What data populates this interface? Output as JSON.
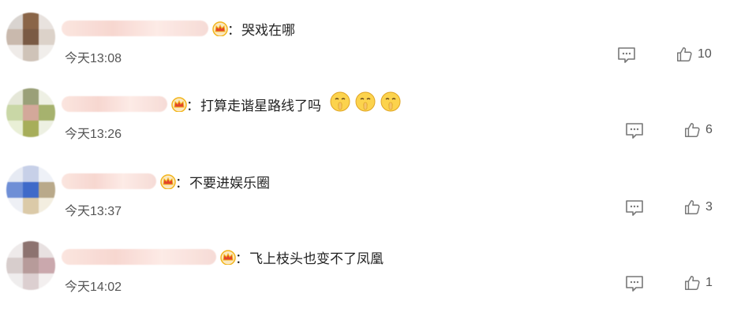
{
  "comments": [
    {
      "text": "哭戏在哪",
      "time": "今天13:08",
      "likes": "10",
      "avatar_colors": [
        "#d9d4d0",
        "#8a6548",
        "#e8e2de",
        "#c9b9ad",
        "#7a5a44",
        "#dcd2c9",
        "#efebe8",
        "#cfc3b8",
        "#f1eeeb"
      ],
      "emoji_count": 0
    },
    {
      "text": "打算走谐星路线了吗",
      "time": "今天13:26",
      "likes": "6",
      "avatar_colors": [
        "#e5e7d8",
        "#9aa078",
        "#eef0e4",
        "#c9d7a6",
        "#d3a89a",
        "#a6b26e",
        "#e9efd6",
        "#a7ae5a",
        "#edf0e2"
      ],
      "emoji_count": 3
    },
    {
      "text": "不要进娱乐圈",
      "time": "今天13:37",
      "likes": "3",
      "avatar_colors": [
        "#e6eaf3",
        "#c7d0e8",
        "#eef1f7",
        "#6f8fd6",
        "#3f6ac9",
        "#b9a98a",
        "#eef0f5",
        "#dbcaa8",
        "#f3eee0"
      ],
      "emoji_count": 0
    },
    {
      "text": "飞上枝头也变不了凤凰",
      "time": "今天14:02",
      "likes": "1",
      "avatar_colors": [
        "#eeeaea",
        "#8d7370",
        "#e8e1e1",
        "#d7cdcc",
        "#b79b9a",
        "#caa8ad",
        "#efeded",
        "#dccfd0",
        "#f3efef"
      ],
      "emoji_count": 0
    }
  ],
  "colon": "：",
  "colors": {
    "icon_gray": "#777777",
    "crown_gold": "#f2b51c",
    "crown_red": "#e2452b"
  }
}
